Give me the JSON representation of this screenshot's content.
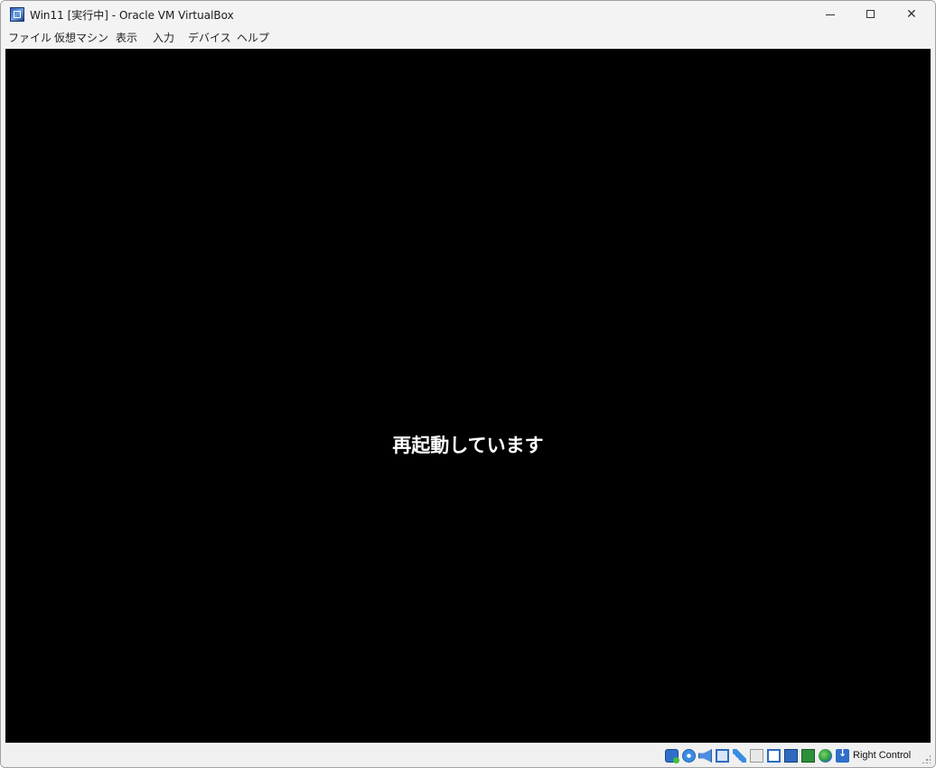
{
  "window": {
    "title": "Win11 [実行中] - Oracle VM VirtualBox",
    "controls": {
      "minimize_glyph": "",
      "maximize_glyph": "",
      "close_glyph": "✕"
    }
  },
  "menubar": {
    "items": [
      "ファイル",
      "仮想マシン",
      "表示",
      "入力",
      "デバイス",
      "ヘルプ"
    ]
  },
  "vm_display": {
    "message": "再起動しています",
    "background_color": "#000000",
    "text_color": "#ffffff"
  },
  "statusbar": {
    "icons": [
      "hard-disk-icon",
      "optical-drive-icon",
      "audio-icon",
      "network-icon",
      "usb-icon",
      "shared-folders-icon",
      "display-icon",
      "video-capture-icon",
      "cpu-activity-icon",
      "mouse-integration-icon",
      "keyboard-capture-icon"
    ],
    "host_key": "Right Control"
  }
}
